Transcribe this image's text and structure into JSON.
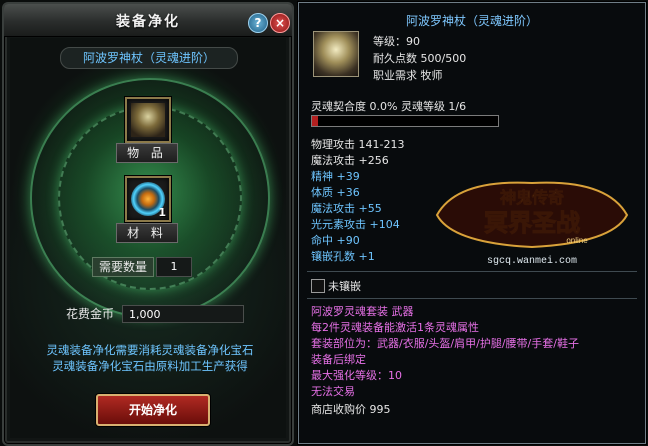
{
  "panel": {
    "title": "装备净化",
    "help_icon": "?",
    "close_icon": "×",
    "item_name": "阿波罗神杖（灵魂进阶）",
    "item_slot_label": "物 品",
    "material_slot_label": "材 料",
    "material_count": "1",
    "quantity_label": "需要数量",
    "quantity_value": "1",
    "gold_label": "花费金币",
    "gold_value": "1,000",
    "description_lines": [
      "灵魂装备净化需要消耗灵魂装备净化宝石",
      "灵魂装备净化宝石由原料加工生产获得"
    ],
    "start_button": "开始净化"
  },
  "tooltip": {
    "title": "阿波罗神杖（灵魂进阶）",
    "level": "等级：90",
    "durability": "耐久点数 500/500",
    "class_req": "职业需求 牧师",
    "soul_line": "灵魂契合度 0.0% 灵魂等级 1/6",
    "soul_progress": 0.03,
    "stats_white": [
      "物理攻击 141-213",
      "魔法攻击 +256"
    ],
    "stats_blue": [
      "精神 +39",
      "体质 +36",
      "魔法攻击 +55",
      "光元素攻击 +104",
      "命中 +90",
      "镶嵌孔数 +1"
    ],
    "unsocketed_label": "未镶嵌",
    "set_lines": [
      "阿波罗灵魂套装 武器",
      "每2件灵魂装备能激活1条灵魂属性",
      "套装部位为：武器/衣服/头盔/肩甲/护腿/腰带/手套/鞋子",
      "装备后绑定",
      "最大强化等级：10",
      "无法交易"
    ],
    "shop_price": "商店收购价 995"
  },
  "logo": {
    "title": "神鬼传奇",
    "subtitle": "冥界圣战",
    "tag": "online",
    "url": "sgcq.wanmei.com"
  },
  "colors": {
    "blue_text": "#6ec5ff",
    "pink_text": "#e670e6",
    "gold": "#d9a23a"
  }
}
